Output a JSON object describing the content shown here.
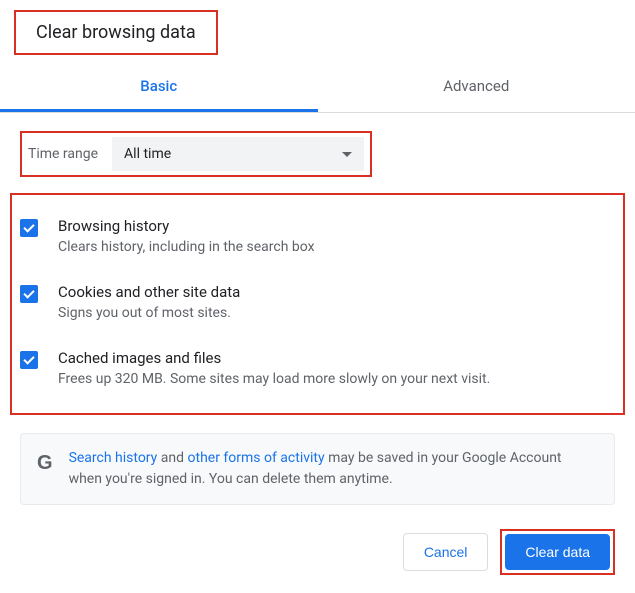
{
  "dialog": {
    "title": "Clear browsing data"
  },
  "tabs": {
    "basic": "Basic",
    "advanced": "Advanced"
  },
  "timeRange": {
    "label": "Time range",
    "value": "All time"
  },
  "options": [
    {
      "title": "Browsing history",
      "desc": "Clears history, including in the search box",
      "checked": true
    },
    {
      "title": "Cookies and other site data",
      "desc": "Signs you out of most sites.",
      "checked": true
    },
    {
      "title": "Cached images and files",
      "desc": "Frees up 320 MB. Some sites may load more slowly on your next visit.",
      "checked": true
    }
  ],
  "info": {
    "link1": "Search history",
    "mid1": " and ",
    "link2": "other forms of activity",
    "rest": " may be saved in your Google Account when you're signed in. You can delete them anytime."
  },
  "buttons": {
    "cancel": "Cancel",
    "clear": "Clear data"
  }
}
